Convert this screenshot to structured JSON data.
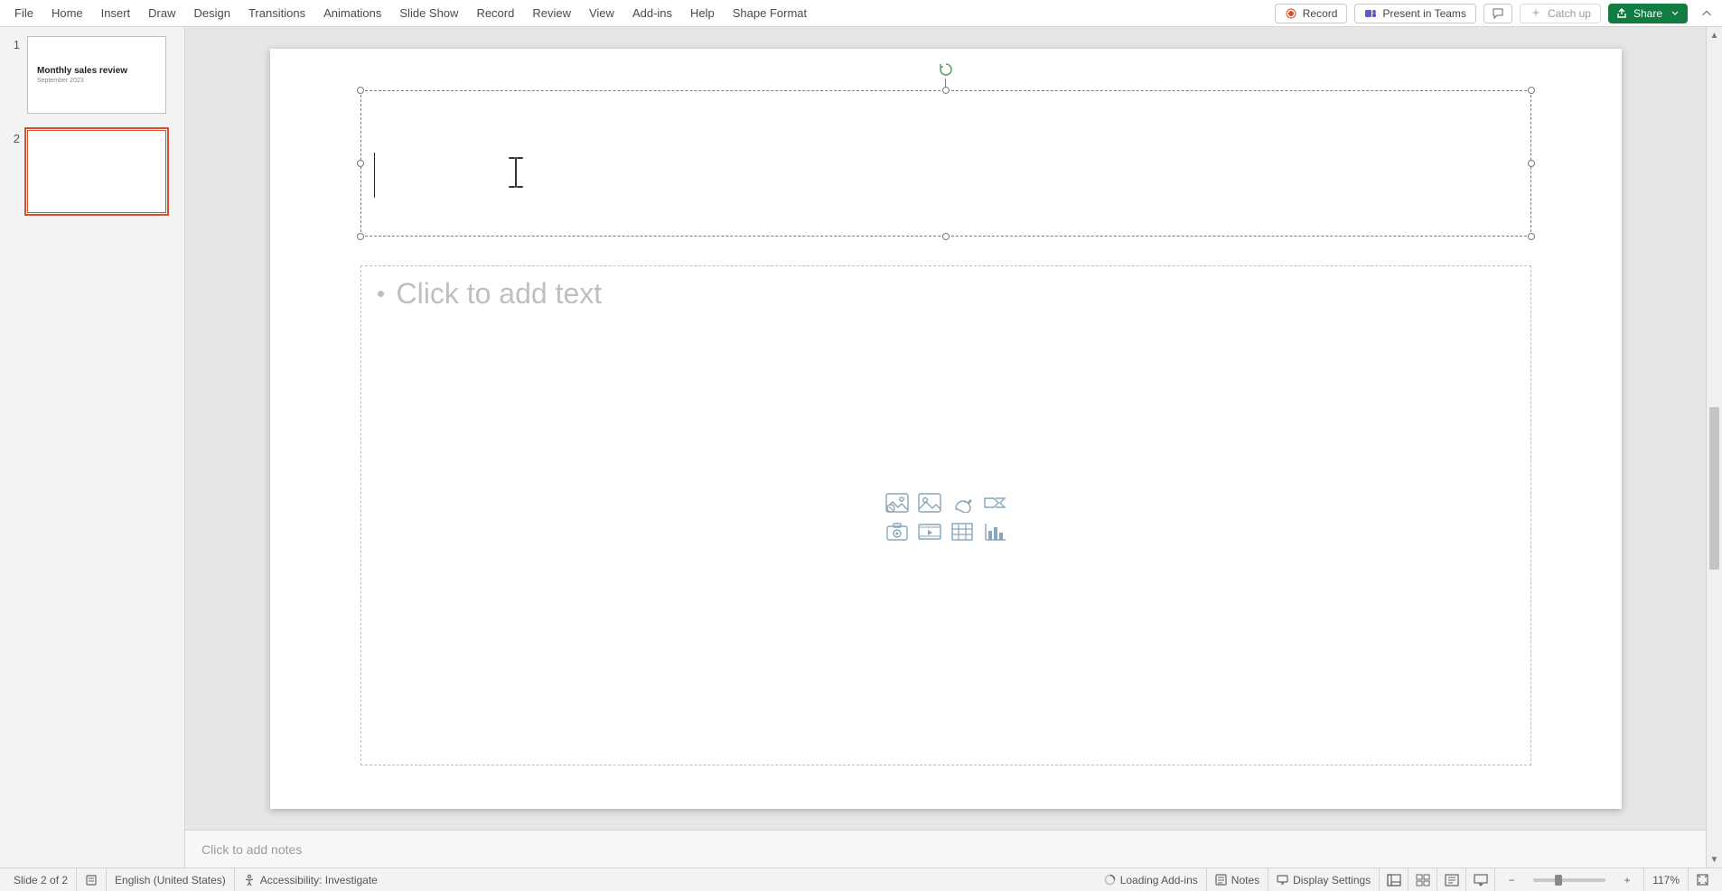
{
  "menu": {
    "file": "File",
    "home": "Home",
    "insert": "Insert",
    "draw": "Draw",
    "design": "Design",
    "transitions": "Transitions",
    "animations": "Animations",
    "slideshow": "Slide Show",
    "record": "Record",
    "review": "Review",
    "view": "View",
    "addins": "Add-ins",
    "help": "Help",
    "shapeformat": "Shape Format"
  },
  "topbar": {
    "record_btn": "Record",
    "present_btn": "Present in Teams",
    "catch_up": "Catch up",
    "share": "Share"
  },
  "thumbnails": {
    "items": [
      {
        "num": "1",
        "title": "Monthly sales review",
        "sub": "September 2023",
        "selected": false
      },
      {
        "num": "2",
        "title": "",
        "sub": "",
        "selected": true
      }
    ]
  },
  "slide": {
    "content_prompt": "Click to add text"
  },
  "notes": {
    "prompt": "Click to add notes"
  },
  "status": {
    "slide_info": "Slide 2 of 2",
    "language": "English (United States)",
    "accessibility": "Accessibility: Investigate",
    "loading": "Loading Add-ins",
    "notes_btn": "Notes",
    "display_btn": "Display Settings",
    "zoom_pct": "117%"
  }
}
